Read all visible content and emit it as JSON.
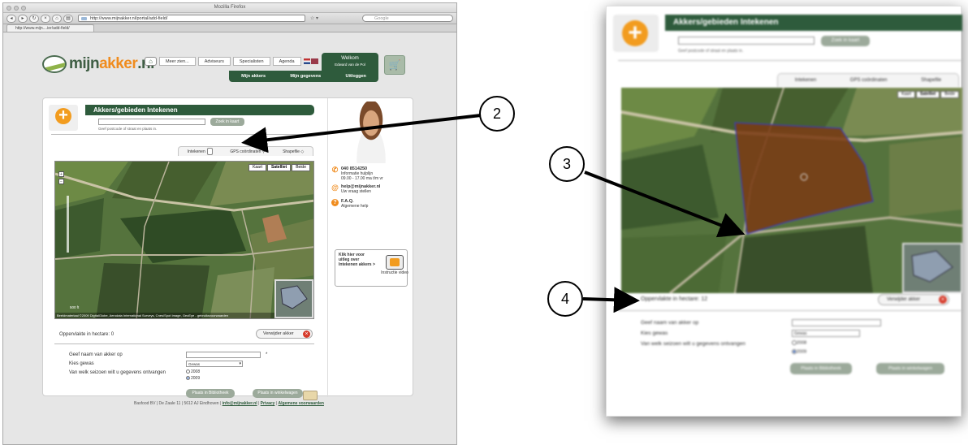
{
  "browser": {
    "window_title": "Mozilla Firefox",
    "url": "http://www.mijnakker.nl/portal/add-field/",
    "search_placeholder": "Google",
    "tab_label": "http://www.mijn....ier/add-field/"
  },
  "site": {
    "logo_main": "mijn",
    "logo_accent": "akker",
    "logo_tld": ".nl",
    "nav": [
      "Meer zien...",
      "Adviseurs",
      "Specialisten",
      "Agenda"
    ],
    "welcome_label": "Welkom",
    "welcome_name": "Edward van de Pol",
    "subnav": [
      "Mijn akkers",
      "Mijn gegevens",
      "Uitloggen"
    ]
  },
  "panel": {
    "title": "Akkers/gebieden Intekenen",
    "search_button": "Zoek in kaart",
    "search_hint": "Geef postcode of straat en plaats in.",
    "tabs": [
      "Intekenen",
      "GPS coördinaten",
      "Shapefile"
    ],
    "map_types": [
      "Kaart",
      "Satelliet",
      "Beide"
    ],
    "map_selected": "Satelliet",
    "map_footer": "Beeldmateriaal ©2009 DigitalGlobe, Aerodata International Surveys, Cnes/Spot Image, GeoEye - gebruiksvoorwaarden",
    "scale_label": "500 ft",
    "area_label": "Oppervlakte in hectare: 0",
    "delete_button": "Verwijder akker",
    "form": {
      "name_label": "Geef naam van akker op",
      "crop_label": "Kies gewas",
      "crop_value": "Gewas",
      "season_label": "Van welk seizoen wilt u gegevens ontvangen",
      "seasons": [
        "2008",
        "2009"
      ],
      "selected_season": "2009",
      "required_marker": "*"
    },
    "btn_library": "Plaats in Bibliotheek",
    "btn_cart": "Plaats in winkelwagen"
  },
  "sidebar": {
    "phone": "040 8514250",
    "phone_note": "Informatie hulplijn",
    "phone_hours": "09.00 - 17.00 ma t/m vr",
    "email": "help@mijnakker.nl",
    "email_note": "Uw vraag stellen",
    "faq": "F.A.Q.",
    "faq_note": "Algemene help",
    "video_text": "Klik hier voor uitleg over Intekenen akkers >",
    "video_label": "Instructie video"
  },
  "footer": {
    "address": "Basfood BV | De Zaale 11 | 5612 AJ Eindhoven |",
    "email_link": "info@mijnakker.nl",
    "privacy": "Privacy",
    "terms": "Algemene voorwaarden"
  },
  "zoom": {
    "area_label": "Oppervlakte in hectare: 12",
    "delete_button": "Verwijder akker",
    "crop_value": "Gewas"
  },
  "callouts": [
    "2",
    "3",
    "4"
  ],
  "colors": {
    "brand_green": "#2e5b3c",
    "brand_orange": "#f29c1f",
    "field_fill": "#7a3b15",
    "delete_red": "#d63b2b"
  }
}
